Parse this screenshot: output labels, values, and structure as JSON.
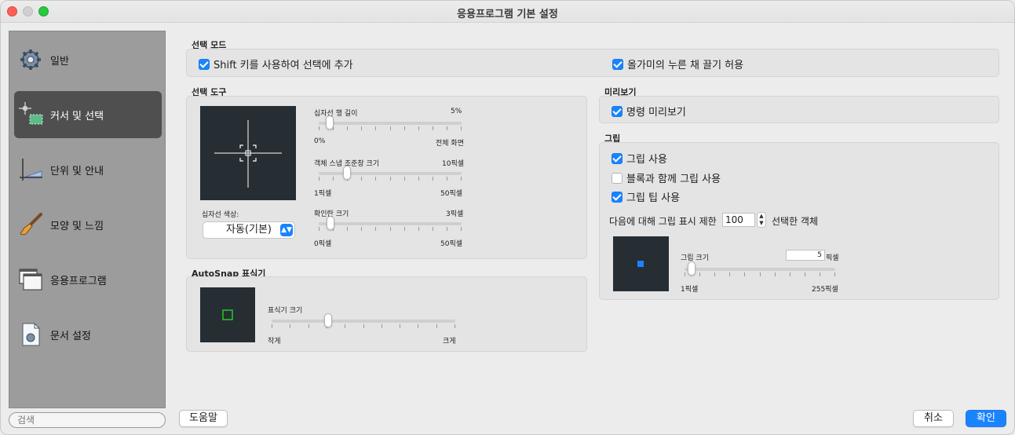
{
  "window": {
    "title": "응용프로그램 기본 설정"
  },
  "sidebar": {
    "items": [
      {
        "label": "일반",
        "icon": "gear-icon"
      },
      {
        "label": "커서 및 선택",
        "icon": "crosshair-selection-icon"
      },
      {
        "label": "단위 및 안내",
        "icon": "ruler-guides-icon"
      },
      {
        "label": "모양 및 느낌",
        "icon": "paintbrush-icon"
      },
      {
        "label": "응용프로그램",
        "icon": "windows-icon"
      },
      {
        "label": "문서 설정",
        "icon": "document-settings-icon"
      }
    ],
    "active_index": 1,
    "search_placeholder": "검색"
  },
  "selection_mode": {
    "title": "선택 모드",
    "shift_add": {
      "label": "Shift 키를 사용하여 선택에 추가",
      "checked": true
    },
    "lasso_drag": {
      "label": "올가미의 누른 채 끌기 허용",
      "checked": true
    }
  },
  "selection_tool": {
    "title": "선택 도구",
    "crosshair_color_label": "십자선 색상:",
    "crosshair_color_value": "자동(기본)",
    "sliders": [
      {
        "label": "십자선 행 길이",
        "value_label": "5%",
        "min_label": "0%",
        "max_label": "전체 화면",
        "value": 0.05
      },
      {
        "label": "객체 스냅 조준창 크기",
        "value_label": "10픽셀",
        "min_label": "1픽셀",
        "max_label": "50픽셀",
        "value": 0.18
      },
      {
        "label": "확인란 크기",
        "value_label": "3픽셀",
        "min_label": "0픽셀",
        "max_label": "50픽셀",
        "value": 0.06
      }
    ]
  },
  "autosnap": {
    "title": "AutoSnap 표식기",
    "slider": {
      "label": "표식기 크기",
      "min_label": "작게",
      "max_label": "크게",
      "value": 0.3
    }
  },
  "preview": {
    "title": "미리보기",
    "command_preview": {
      "label": "명령 미리보기",
      "checked": true
    }
  },
  "grip": {
    "title": "그립",
    "use_grip": {
      "label": "그립 사용",
      "checked": true
    },
    "grip_in_blocks": {
      "label": "블록과 함께 그립 사용",
      "checked": false
    },
    "grip_tips": {
      "label": "그립 팁 사용",
      "checked": true
    },
    "limit_prefix": "다음에 대해 그립 표시 제한",
    "limit_value": "100",
    "limit_suffix": "선택한 객체",
    "size_label": "그립 크기",
    "size_value": "5",
    "size_unit": "픽셀",
    "size_min_label": "1픽셀",
    "size_max_label": "255픽셀",
    "size_slider_value": 0.02
  },
  "buttons": {
    "help": "도움말",
    "cancel": "취소",
    "ok": "확인"
  },
  "colors": {
    "accent": "#1a84ff",
    "preview_bg": "#262d33",
    "autosnap_marker": "#22cc22",
    "grip_marker": "#1a84ff"
  }
}
